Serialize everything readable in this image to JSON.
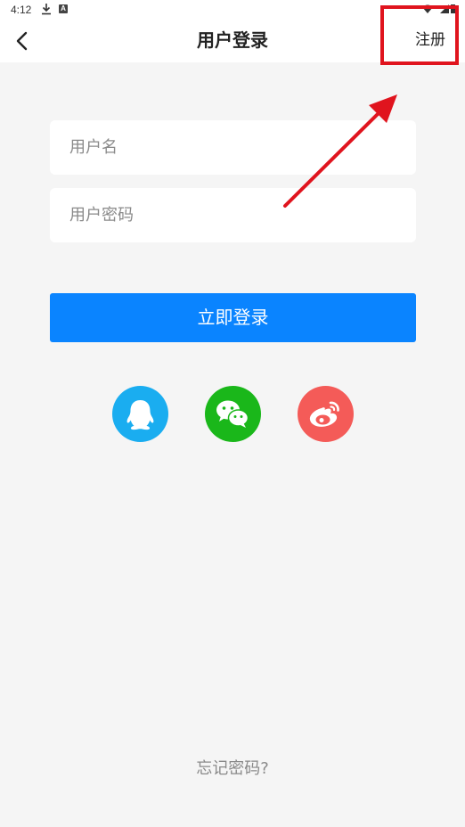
{
  "status_bar": {
    "time": "4:12"
  },
  "app_bar": {
    "title": "用户登录",
    "register_label": "注册"
  },
  "form": {
    "username_placeholder": "用户名",
    "password_placeholder": "用户密码",
    "login_label": "立即登录"
  },
  "social": {
    "icons": [
      "qq-icon",
      "wechat-icon",
      "weibo-icon"
    ],
    "colors": {
      "qq": "#1aadf0",
      "wechat": "#1ab71a",
      "weibo": "#f45b58"
    }
  },
  "footer": {
    "forgot_label": "忘记密码?"
  },
  "accent_color": "#0a84ff",
  "annotation_color": "#e0141e"
}
